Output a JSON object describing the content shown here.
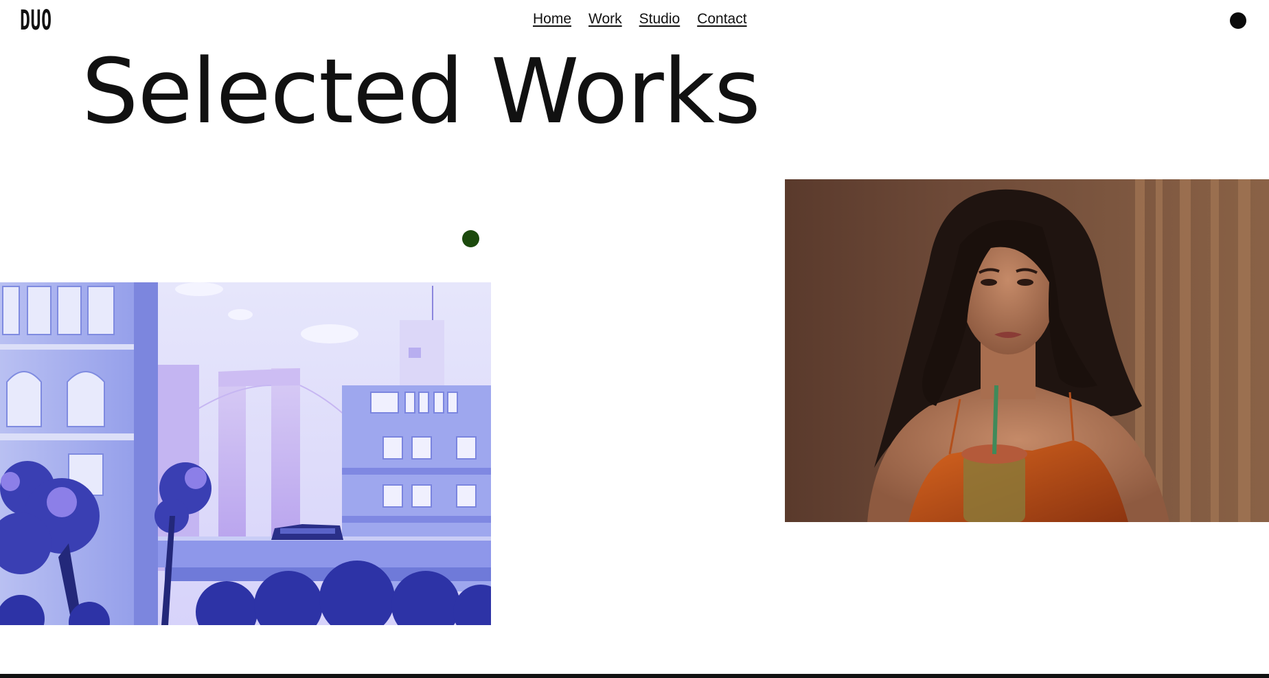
{
  "brand": {
    "logo_text": "DUO"
  },
  "nav": {
    "items": [
      {
        "label": "Home"
      },
      {
        "label": "Work"
      },
      {
        "label": "Studio"
      },
      {
        "label": "Contact"
      }
    ]
  },
  "hero": {
    "title": "Selected Works"
  },
  "colors": {
    "text": "#111111",
    "background": "#ffffff",
    "cursor_dot": "#1c4a0d",
    "menu_dot": "#0b0b0b"
  },
  "works": [
    {
      "image": "city-illustration"
    },
    {
      "image": "portrait-woman"
    }
  ],
  "icons": {
    "menu": "menu-dot-icon"
  }
}
